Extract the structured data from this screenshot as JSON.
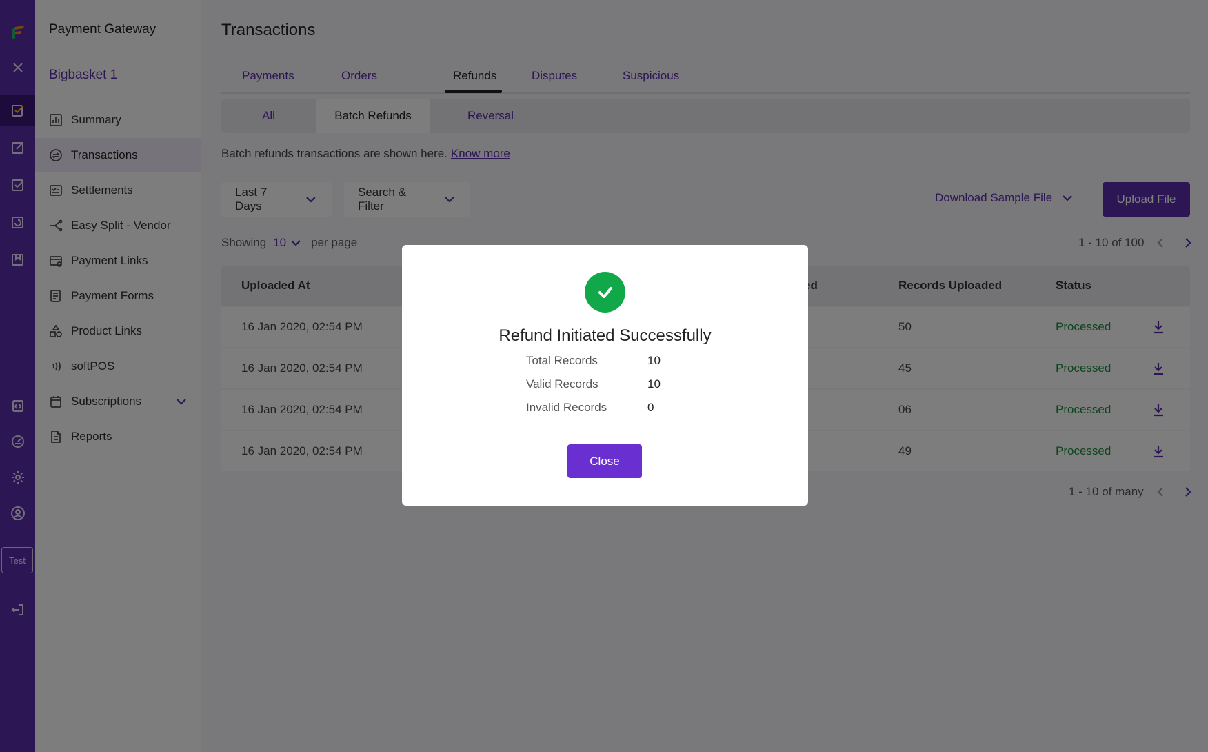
{
  "app": {
    "title": "Payment Gateway",
    "merchant": "Bigbasket 1",
    "env_badge": "Test"
  },
  "rail_icons": [
    "logo-icon",
    "close-icon",
    "transactions-rail-icon",
    "export-rail-icon",
    "check-rail-icon",
    "refresh-rail-icon",
    "document-rail-icon",
    "code-rail-icon",
    "dashboard-rail-icon",
    "settings-icon",
    "profile-icon",
    "logout-icon"
  ],
  "sidebar": {
    "items": [
      {
        "label": "Summary",
        "icon": "chart-icon"
      },
      {
        "label": "Transactions",
        "icon": "transactions-icon",
        "active": true
      },
      {
        "label": "Settlements",
        "icon": "settlements-icon"
      },
      {
        "label": "Easy Split -  Vendor",
        "icon": "split-icon"
      },
      {
        "label": "Payment Links",
        "icon": "link-icon"
      },
      {
        "label": "Payment Forms",
        "icon": "form-icon"
      },
      {
        "label": "Product Links",
        "icon": "shapes-icon"
      },
      {
        "label": "softPOS",
        "icon": "contactless-icon"
      },
      {
        "label": "Subscriptions",
        "icon": "calendar-icon",
        "expandable": true
      },
      {
        "label": "Reports",
        "icon": "report-icon"
      }
    ]
  },
  "main": {
    "title": "Transactions",
    "tabs": [
      "Payments",
      "Orders",
      "Refunds",
      "Disputes",
      "Suspicious"
    ],
    "active_tab": "Refunds",
    "subtabs": [
      "All",
      "Batch Refunds",
      "Reversal"
    ],
    "active_subtab": "Batch Refunds",
    "description": "Batch refunds transactions are shown here.",
    "know_more": "Know more",
    "filters": {
      "date_range": "Last 7 Days",
      "search_filter": "Search & Filter"
    },
    "download_sample": "Download Sample File",
    "upload_button": "Upload File",
    "showing_label": "Showing",
    "per_page_value": "10",
    "per_page_label": "per page",
    "pagination_top": "1 - 10 of 100",
    "pagination_bottom": "1 - 10 of many",
    "table": {
      "headers": [
        "Uploaded At",
        "ed",
        "Records Uploaded",
        "Status"
      ],
      "rows": [
        {
          "uploaded_at": "16 Jan 2020, 02:54 PM",
          "records": "50",
          "status": "Processed"
        },
        {
          "uploaded_at": "16 Jan 2020, 02:54 PM",
          "records": "45",
          "status": "Processed"
        },
        {
          "uploaded_at": "16 Jan 2020, 02:54 PM",
          "records": "06",
          "status": "Processed"
        },
        {
          "uploaded_at": "16 Jan 2020, 02:54 PM",
          "records": "49",
          "status": "Processed"
        }
      ]
    }
  },
  "modal": {
    "title": "Refund Initiated Successfully",
    "stats": [
      {
        "label": "Total Records",
        "value": "10"
      },
      {
        "label": "Valid Records",
        "value": "10"
      },
      {
        "label": "Invalid Records",
        "value": "0"
      }
    ],
    "close_label": "Close"
  },
  "colors": {
    "brand": "#5a2ca8",
    "success": "#11a84a",
    "status_processed": "#1d8a3e",
    "button_primary": "#6a2fd0"
  }
}
